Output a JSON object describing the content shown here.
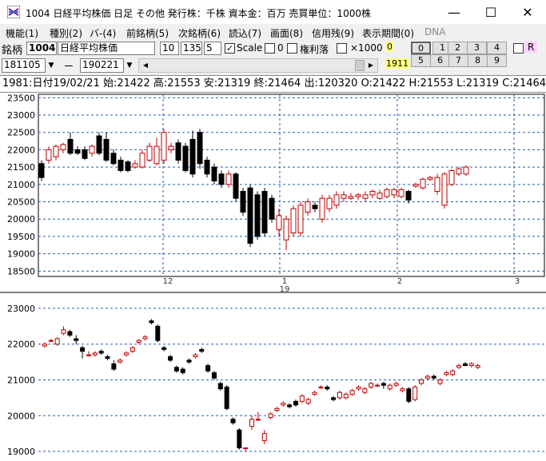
{
  "window": {
    "title": "1004 日経平均株価  日足  その他  発行株：千株  資本金：百万  売買単位：1000株",
    "minimize_glyph": "—",
    "maximize_glyph": "☐",
    "close_glyph": "✕"
  },
  "menu": [
    {
      "label": "機能(1)"
    },
    {
      "label": "種別(2)"
    },
    {
      "label": "バ-(4)"
    },
    {
      "label": "前銘柄(5)"
    },
    {
      "label": "次銘柄(6)"
    },
    {
      "label": "読込(7)"
    },
    {
      "label": "画面(8)"
    },
    {
      "label": "信用残(9)"
    },
    {
      "label": "表示期間(0)"
    },
    {
      "label": "DNA"
    }
  ],
  "toolbar": {
    "code_label": "銘柄",
    "code_value": "1004",
    "name_value": "日経平均株価",
    "field_a": "10",
    "field_b": "1350",
    "field_c": "5",
    "scale_checked": "✓",
    "scale_label": "Scale",
    "zero_label": "0",
    "kenri_label": "権利落",
    "x1000_label": "×1000",
    "yellow_zero": "0",
    "start_date": "181105",
    "dash": "ー",
    "end_date": "190221",
    "dropdown_glyph": "▼",
    "scroll_left": "◀",
    "scroll_right": "▶",
    "yellow_count": "1911",
    "num_buttons": [
      "0",
      "1",
      "2",
      "3",
      "4",
      "5",
      "6",
      "7",
      "8",
      "9"
    ],
    "r_label": "R"
  },
  "infobar": {
    "text": "1981:日付19/02/21 始:21422 高:21553 安:21319 終:21464 出:120320 O:21422 H:21553 L:21319 C:21464"
  },
  "colors": {
    "up": "#c00000",
    "down": "#000000",
    "grid": "#2060b0"
  },
  "chart_data": [
    {
      "type": "candlestick",
      "title": "",
      "x_tick_labels": [
        "12",
        "1",
        "19",
        "2",
        "3"
      ],
      "ylim": [
        18300,
        23600
      ],
      "y_ticks": [
        18500,
        19000,
        19500,
        20000,
        20500,
        21000,
        21500,
        22000,
        22500,
        23000,
        23500
      ],
      "grid": true,
      "bar_interval": "weekly",
      "candles": [
        [
          21600,
          21200,
          21700,
          21100
        ],
        [
          21700,
          22000,
          22100,
          21600
        ],
        [
          21800,
          22100,
          22150,
          21700
        ],
        [
          22000,
          22150,
          22200,
          21900
        ],
        [
          22300,
          21900,
          22500,
          21850
        ],
        [
          22000,
          21900,
          22100,
          21850
        ],
        [
          22000,
          21750,
          22100,
          21700
        ],
        [
          21900,
          22100,
          22150,
          21800
        ],
        [
          22400,
          21900,
          22500,
          21850
        ],
        [
          22300,
          21700,
          22500,
          21650
        ],
        [
          21900,
          21600,
          22000,
          21550
        ],
        [
          21700,
          21400,
          21800,
          21350
        ],
        [
          21650,
          21400,
          21700,
          21350
        ],
        [
          21500,
          21600,
          21700,
          21450
        ],
        [
          21500,
          21900,
          22000,
          21450
        ],
        [
          21700,
          22100,
          22200,
          21650
        ],
        [
          21600,
          22100,
          22350,
          21550
        ],
        [
          21700,
          22500,
          22600,
          21600
        ],
        [
          22000,
          22100,
          22200,
          21900
        ],
        [
          22200,
          21700,
          22300,
          21600
        ],
        [
          22100,
          21400,
          22200,
          21350
        ],
        [
          22300,
          21300,
          22550,
          21200
        ],
        [
          22500,
          21600,
          22600,
          21450
        ],
        [
          21700,
          21300,
          21800,
          21200
        ],
        [
          21500,
          21100,
          21600,
          21000
        ],
        [
          21300,
          21000,
          21400,
          20900
        ],
        [
          21000,
          21300,
          21400,
          20900
        ],
        [
          21300,
          20600,
          21350,
          20500
        ],
        [
          20800,
          20200,
          20900,
          20100
        ],
        [
          20900,
          19300,
          21000,
          19200
        ],
        [
          20700,
          19500,
          20800,
          19400
        ],
        [
          20800,
          19600,
          20900,
          19500
        ],
        [
          20600,
          20000,
          20700,
          19900
        ],
        [
          19700,
          20100,
          20300,
          19500
        ],
        [
          19400,
          20000,
          20100,
          19100
        ],
        [
          19600,
          20300,
          20400,
          19500
        ],
        [
          19600,
          20400,
          20500,
          19500
        ],
        [
          20200,
          20500,
          20600,
          20100
        ],
        [
          20400,
          20300,
          20500,
          20200
        ],
        [
          20000,
          20600,
          20700,
          19900
        ],
        [
          20300,
          20600,
          20700,
          20200
        ],
        [
          20400,
          20700,
          20800,
          20300
        ],
        [
          20600,
          20700,
          20800,
          20500
        ],
        [
          20600,
          20650,
          20750,
          20550
        ],
        [
          20650,
          20700,
          20750,
          20550
        ],
        [
          20600,
          20700,
          20800,
          20500
        ],
        [
          20700,
          20800,
          20850,
          20600
        ],
        [
          20600,
          20750,
          20850,
          20550
        ],
        [
          20650,
          20850,
          20900,
          20600
        ],
        [
          20700,
          20850,
          20900,
          20600
        ],
        [
          20650,
          20850,
          20900,
          20600
        ],
        [
          20800,
          20550,
          20850,
          20450
        ],
        [
          20950,
          21000,
          21050,
          20900
        ],
        [
          20900,
          21150,
          21200,
          20850
        ],
        [
          21150,
          21200,
          21250,
          21100
        ],
        [
          20800,
          21200,
          21300,
          20700
        ],
        [
          20400,
          21300,
          21350,
          20300
        ],
        [
          21000,
          21400,
          21450,
          20950
        ],
        [
          21300,
          21450,
          21500,
          21250
        ],
        [
          21300,
          21500,
          21550,
          21250
        ]
      ]
    },
    {
      "type": "candlestick",
      "title": "",
      "ylim": [
        18800,
        23400
      ],
      "y_ticks": [
        19000,
        20000,
        21000,
        22000,
        23000
      ],
      "grid": true,
      "bar_interval": "daily",
      "candles": [
        [
          21950,
          22000,
          22050,
          21900
        ],
        [
          22100,
          22100,
          22150,
          22050
        ],
        [
          22000,
          22150,
          22200,
          21950
        ],
        [
          22300,
          22400,
          22500,
          22250
        ],
        [
          22350,
          22250,
          22400,
          22200
        ],
        [
          22150,
          22100,
          22250,
          22000
        ],
        [
          21900,
          21800,
          21950,
          21600
        ],
        [
          21700,
          21700,
          21800,
          21650
        ],
        [
          21700,
          21750,
          21800,
          21650
        ],
        [
          21800,
          21750,
          21850,
          21700
        ],
        [
          21650,
          21600,
          21700,
          21550
        ],
        [
          21450,
          21300,
          21550,
          21250
        ],
        [
          21500,
          21550,
          21600,
          21450
        ],
        [
          21700,
          21750,
          21800,
          21650
        ],
        [
          21800,
          21900,
          21950,
          21750
        ],
        [
          22050,
          22100,
          22150,
          22000
        ],
        [
          22150,
          22200,
          22250,
          22100
        ],
        [
          22650,
          22600,
          22700,
          22550
        ],
        [
          22500,
          22100,
          22550,
          22050
        ],
        [
          21900,
          21850,
          21950,
          21800
        ],
        [
          21650,
          21550,
          21700,
          21500
        ],
        [
          21350,
          21250,
          21400,
          21200
        ],
        [
          21300,
          21200,
          21350,
          21150
        ],
        [
          21550,
          21500,
          21600,
          21450
        ],
        [
          21650,
          21700,
          21750,
          21600
        ],
        [
          21850,
          21800,
          21900,
          21750
        ],
        [
          21400,
          21250,
          21450,
          21200
        ],
        [
          21200,
          21050,
          21250,
          21000
        ],
        [
          20900,
          20750,
          20950,
          20700
        ],
        [
          20800,
          20200,
          20850,
          20150
        ],
        [
          19900,
          19800,
          19950,
          19750
        ],
        [
          19600,
          19100,
          19650,
          19050
        ],
        [
          19100,
          19100,
          19100,
          19000
        ],
        [
          19700,
          19900,
          20000,
          19600
        ],
        [
          19900,
          19900,
          20100,
          19850
        ],
        [
          19300,
          19500,
          19600,
          19200
        ],
        [
          19950,
          20050,
          20100,
          19900
        ],
        [
          20150,
          20200,
          20250,
          20100
        ],
        [
          20300,
          20350,
          20400,
          20250
        ],
        [
          20300,
          20250,
          20350,
          20200
        ],
        [
          20400,
          20300,
          20450,
          20250
        ],
        [
          20400,
          20550,
          20600,
          20350
        ],
        [
          20350,
          20450,
          20500,
          20300
        ],
        [
          20600,
          20650,
          20700,
          20550
        ],
        [
          20800,
          20800,
          20850,
          20750
        ],
        [
          20800,
          20750,
          20850,
          20700
        ],
        [
          20500,
          20450,
          20550,
          20400
        ],
        [
          20500,
          20650,
          20700,
          20450
        ],
        [
          20500,
          20600,
          20650,
          20450
        ],
        [
          20600,
          20700,
          20750,
          20550
        ],
        [
          20750,
          20800,
          20850,
          20700
        ],
        [
          20650,
          20750,
          20800,
          20600
        ],
        [
          20800,
          20900,
          20950,
          20750
        ],
        [
          20850,
          20850,
          20900,
          20800
        ],
        [
          20900,
          20850,
          20950,
          20750
        ],
        [
          20750,
          20850,
          20900,
          20700
        ],
        [
          20850,
          20900,
          20950,
          20800
        ],
        [
          20700,
          20750,
          20800,
          20650
        ],
        [
          20750,
          20400,
          20800,
          20350
        ],
        [
          20450,
          20800,
          20850,
          20400
        ],
        [
          20900,
          21000,
          21050,
          20850
        ],
        [
          21050,
          21100,
          21150,
          21000
        ],
        [
          21100,
          21050,
          21150,
          21000
        ],
        [
          20900,
          21000,
          21050,
          20850
        ],
        [
          21150,
          21200,
          21250,
          21100
        ],
        [
          21150,
          21250,
          21300,
          21100
        ],
        [
          21350,
          21400,
          21450,
          21300
        ],
        [
          21450,
          21400,
          21500,
          21400
        ],
        [
          21400,
          21450,
          21500,
          21350
        ],
        [
          21350,
          21400,
          21450,
          21300
        ]
      ]
    }
  ]
}
